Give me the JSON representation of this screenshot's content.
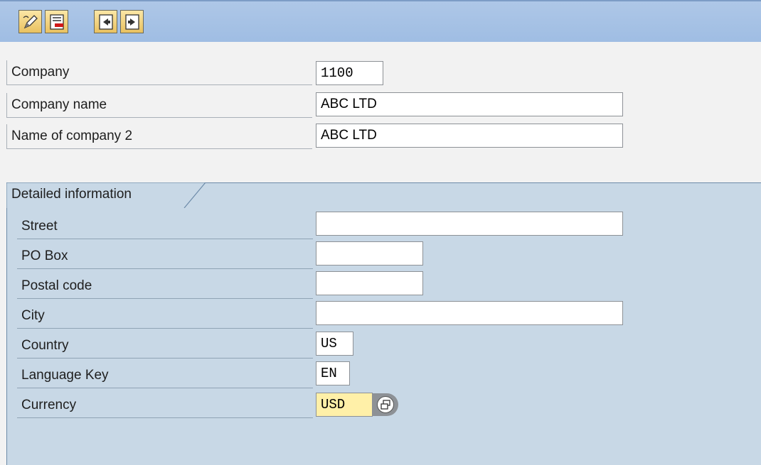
{
  "toolbar": {
    "buttons": [
      {
        "icon": "pencil-icon"
      },
      {
        "icon": "delete-entry-icon"
      },
      {
        "icon": "previous-entry-icon"
      },
      {
        "icon": "next-entry-icon"
      }
    ]
  },
  "header": {
    "company_label": "Company",
    "company_value": "1100",
    "company_name_label": "Company name",
    "company_name_value": "ABC LTD",
    "company_name2_label": "Name of company 2",
    "company_name2_value": "ABC LTD"
  },
  "detail": {
    "title": "Detailed information",
    "street_label": "Street",
    "street_value": "",
    "pobox_label": "PO Box",
    "pobox_value": "",
    "postal_label": "Postal code",
    "postal_value": "",
    "city_label": "City",
    "city_value": "",
    "country_label": "Country",
    "country_value": "US",
    "language_label": "Language Key",
    "language_value": "EN",
    "currency_label": "Currency",
    "currency_value": "USD"
  },
  "colors": {
    "toolbar": "#a7c2e5",
    "group_background": "#c8d8e6",
    "focused_field": "#fff0a8",
    "button_gold": "#f0cf73"
  }
}
